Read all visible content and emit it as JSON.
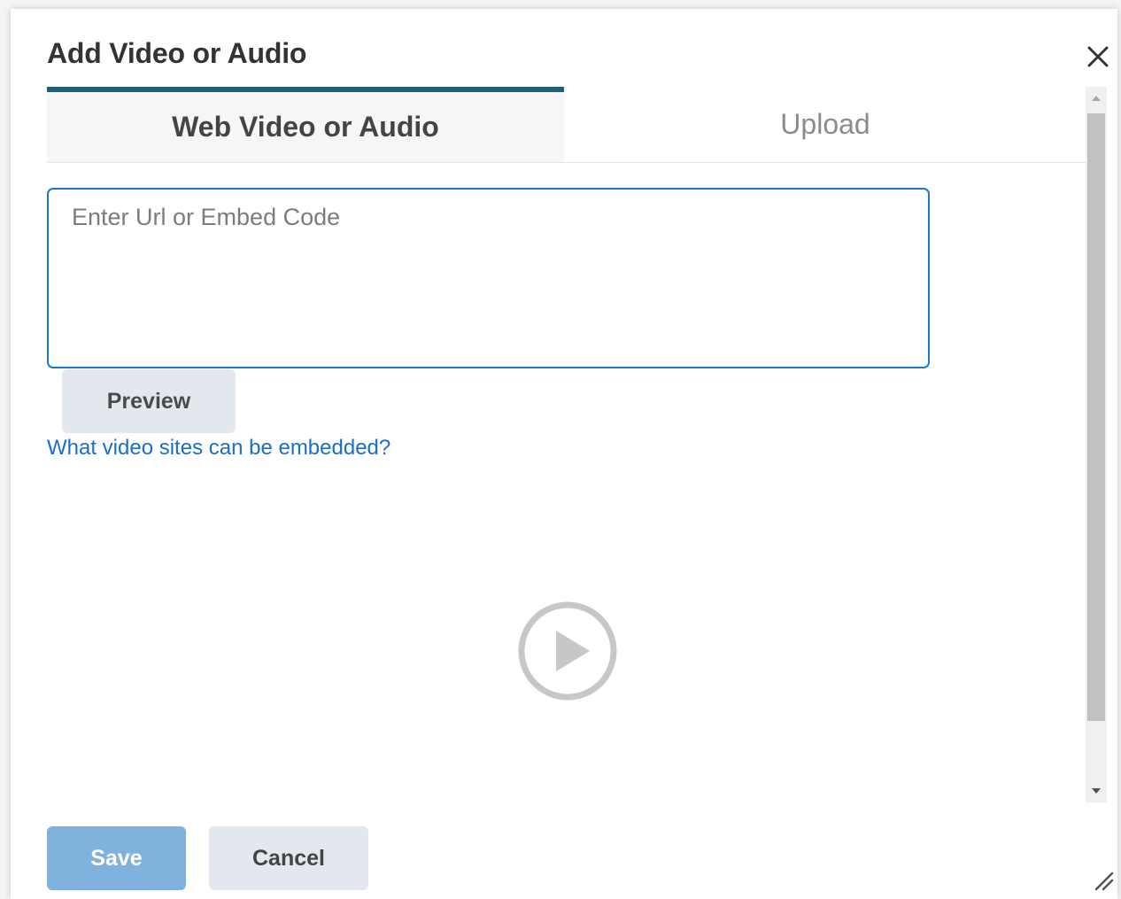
{
  "dialog": {
    "title": "Add Video or Audio",
    "close_icon": "close-icon"
  },
  "tabs": [
    {
      "label": "Web Video or Audio",
      "active": true
    },
    {
      "label": "Upload",
      "active": false
    }
  ],
  "url_input": {
    "value": "",
    "placeholder": "Enter Url or Embed Code"
  },
  "preview_button": {
    "label": "Preview"
  },
  "help_link": {
    "label": "What video sites can be embedded?"
  },
  "preview_area": {
    "icon": "play-icon"
  },
  "footer": {
    "save_label": "Save",
    "cancel_label": "Cancel"
  },
  "colors": {
    "accent": "#1f5f7a",
    "input_border": "#1b79c8",
    "link": "#1b6fc4",
    "save_disabled": "#7fb3de",
    "secondary_button": "#e3e8ef"
  }
}
